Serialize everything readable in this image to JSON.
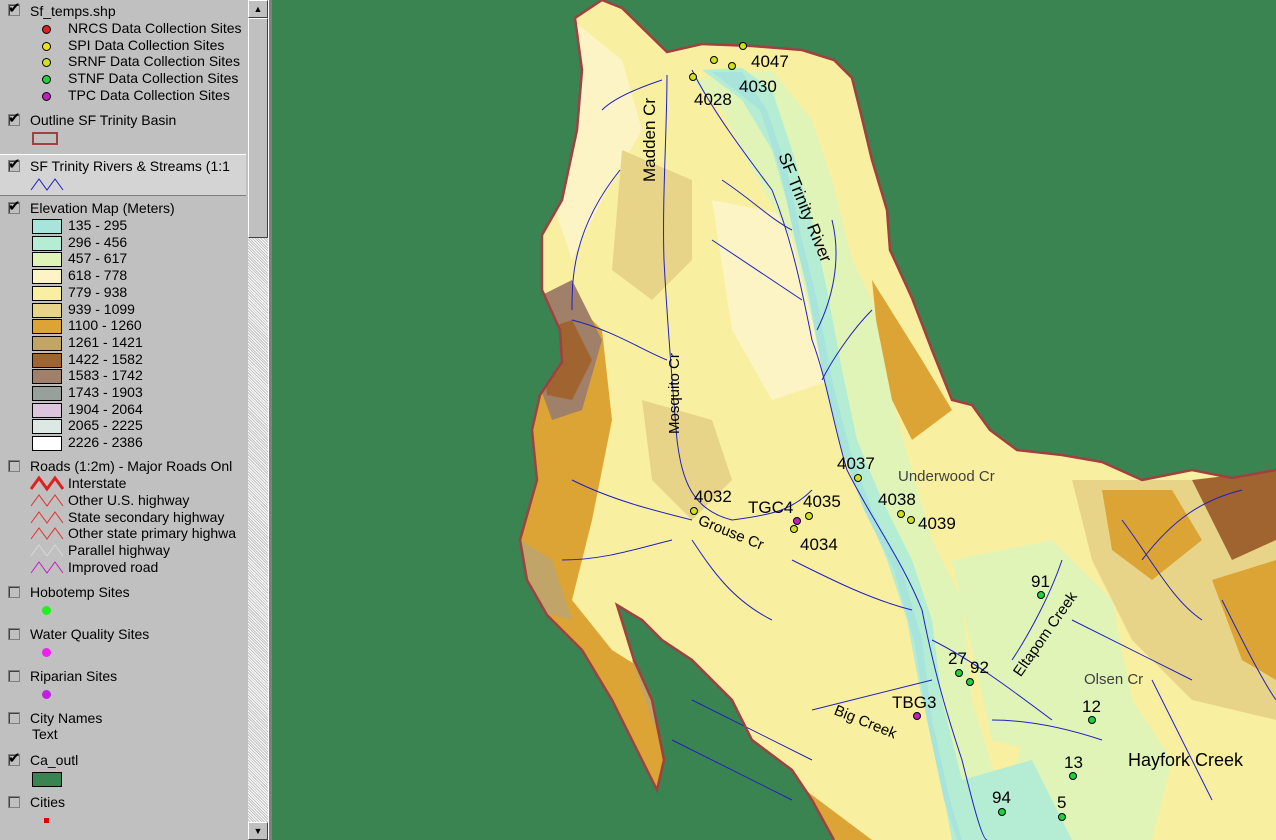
{
  "toc": {
    "layers": [
      {
        "name": "Sf_temps.shp",
        "checked": true,
        "items": [
          {
            "label": "NRCS Data Collection Sites",
            "color": "#e02020"
          },
          {
            "label": "SPI Data Collection Sites",
            "color": "#f0e020"
          },
          {
            "label": "SRNF Data Collection Sites",
            "color": "#d0e020"
          },
          {
            "label": "STNF Data Collection Sites",
            "color": "#20d040"
          },
          {
            "label": "TPC Data Collection Sites",
            "color": "#c020c0"
          }
        ]
      },
      {
        "name": "Outline SF Trinity Basin",
        "checked": true
      },
      {
        "name": "SF Trinity Rivers & Streams (1:1",
        "checked": true
      },
      {
        "name": "Elevation Map (Meters)",
        "checked": true,
        "classes": [
          {
            "label": "135 - 295",
            "color": "#a8e4dc"
          },
          {
            "label": "296 - 456",
            "color": "#b4ecd4"
          },
          {
            "label": "457 - 617",
            "color": "#e0f4b8"
          },
          {
            "label": "618 - 778",
            "color": "#fcf4c4"
          },
          {
            "label": "779 - 938",
            "color": "#f8f0a0"
          },
          {
            "label": "939 - 1099",
            "color": "#e8d488"
          },
          {
            "label": "1100 - 1260",
            "color": "#dca434"
          },
          {
            "label": "1261 - 1421",
            "color": "#c0a468"
          },
          {
            "label": "1422 - 1582",
            "color": "#a06430"
          },
          {
            "label": "1583 - 1742",
            "color": "#a08068"
          },
          {
            "label": "1743 - 1903",
            "color": "#98a09c"
          },
          {
            "label": "1904 - 2064",
            "color": "#dcc4dc"
          },
          {
            "label": "2065 - 2225",
            "color": "#dce8e4"
          },
          {
            "label": "2226 - 2386",
            "color": "#ffffff"
          }
        ]
      },
      {
        "name": "Roads (1:2m) - Major Roads Onl",
        "checked": false,
        "items": [
          {
            "label": "Interstate"
          },
          {
            "label": "Other U.S. highway"
          },
          {
            "label": "State secondary highway"
          },
          {
            "label": "Other state primary highwa"
          },
          {
            "label": "Parallel highway"
          },
          {
            "label": "Improved road"
          }
        ]
      },
      {
        "name": "Hobotemp Sites",
        "checked": false,
        "color": "#20f020"
      },
      {
        "name": "Water Quality Sites",
        "checked": false,
        "color": "#f020f0"
      },
      {
        "name": "Riparian Sites",
        "checked": false,
        "color": "#c020e0"
      },
      {
        "name": "City Names",
        "checked": false,
        "sub": "Text"
      },
      {
        "name": "Ca_outl",
        "checked": true,
        "color": "#3a8452"
      },
      {
        "name": "Cities",
        "checked": false,
        "color": "#e00000"
      }
    ]
  },
  "map": {
    "labels": [
      {
        "text": "Madden Cr"
      },
      {
        "text": "SF Trinity River"
      },
      {
        "text": "Mosquito Cr"
      },
      {
        "text": "Grouse Cr"
      },
      {
        "text": "Underwood Cr"
      },
      {
        "text": "Eltapom Creek"
      },
      {
        "text": "Olsen Cr"
      },
      {
        "text": "Big Creek"
      },
      {
        "text": "Hayfork Creek"
      }
    ],
    "sites": [
      {
        "id": "4047",
        "agency": "SRNF"
      },
      {
        "id": "4030",
        "agency": "SRNF"
      },
      {
        "id": "4028",
        "agency": "SRNF"
      },
      {
        "id": "4037",
        "agency": "SRNF"
      },
      {
        "id": "4032",
        "agency": "SRNF"
      },
      {
        "id": "4035",
        "agency": "SRNF"
      },
      {
        "id": "4034",
        "agency": "SRNF"
      },
      {
        "id": "4038",
        "agency": "SRNF"
      },
      {
        "id": "4039",
        "agency": "SRNF"
      },
      {
        "id": "TGC4",
        "agency": "TPC"
      },
      {
        "id": "TBG3",
        "agency": "TPC"
      },
      {
        "id": "91",
        "agency": "STNF"
      },
      {
        "id": "27",
        "agency": "STNF"
      },
      {
        "id": "92",
        "agency": "STNF"
      },
      {
        "id": "12",
        "agency": "STNF"
      },
      {
        "id": "13",
        "agency": "STNF"
      },
      {
        "id": "94",
        "agency": "STNF"
      },
      {
        "id": "5",
        "agency": "STNF"
      }
    ]
  },
  "colors": {
    "outside": "#3a8452",
    "basin_outline": "#a04040",
    "streams": "#2020c0"
  }
}
